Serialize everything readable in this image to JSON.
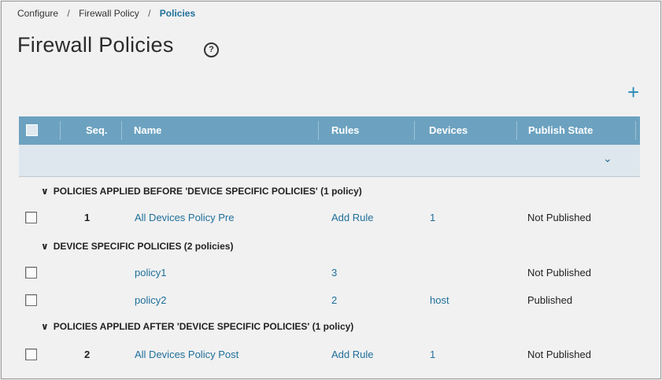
{
  "breadcrumb": {
    "item1": "Configure",
    "item2": "Firewall Policy",
    "item3": "Policies",
    "separator": "/"
  },
  "page": {
    "title": "Firewall Policies",
    "help_icon": "?",
    "add_icon": "+"
  },
  "table": {
    "columns": {
      "seq": "Seq.",
      "name": "Name",
      "rules": "Rules",
      "devices": "Devices",
      "publish_state": "Publish State"
    },
    "filter_icon": "⌄"
  },
  "groups": [
    {
      "title": "POLICIES APPLIED BEFORE 'DEVICE SPECIFIC POLICIES' (1 policy)",
      "rows": [
        {
          "seq": "1",
          "name": "All Devices Policy Pre",
          "rules": "Add Rule",
          "devices": "1",
          "publish_state": "Not Published"
        }
      ]
    },
    {
      "title": "DEVICE SPECIFIC POLICIES (2 policies)",
      "rows": [
        {
          "seq": "",
          "name": "policy1",
          "rules": "3",
          "devices": "",
          "publish_state": "Not Published"
        },
        {
          "seq": "",
          "name": "policy2",
          "rules": "2",
          "devices": "host",
          "publish_state": "Published"
        }
      ]
    },
    {
      "title": "POLICIES APPLIED AFTER 'DEVICE SPECIFIC POLICIES' (1 policy)",
      "rows": [
        {
          "seq": "2",
          "name": "All Devices Policy Post",
          "rules": "Add Rule",
          "devices": "1",
          "publish_state": "Not Published"
        }
      ]
    }
  ],
  "colors": {
    "accent": "#1f6f9a",
    "header_bg": "#6ca2c0",
    "filter_bg": "#dde7ed"
  }
}
